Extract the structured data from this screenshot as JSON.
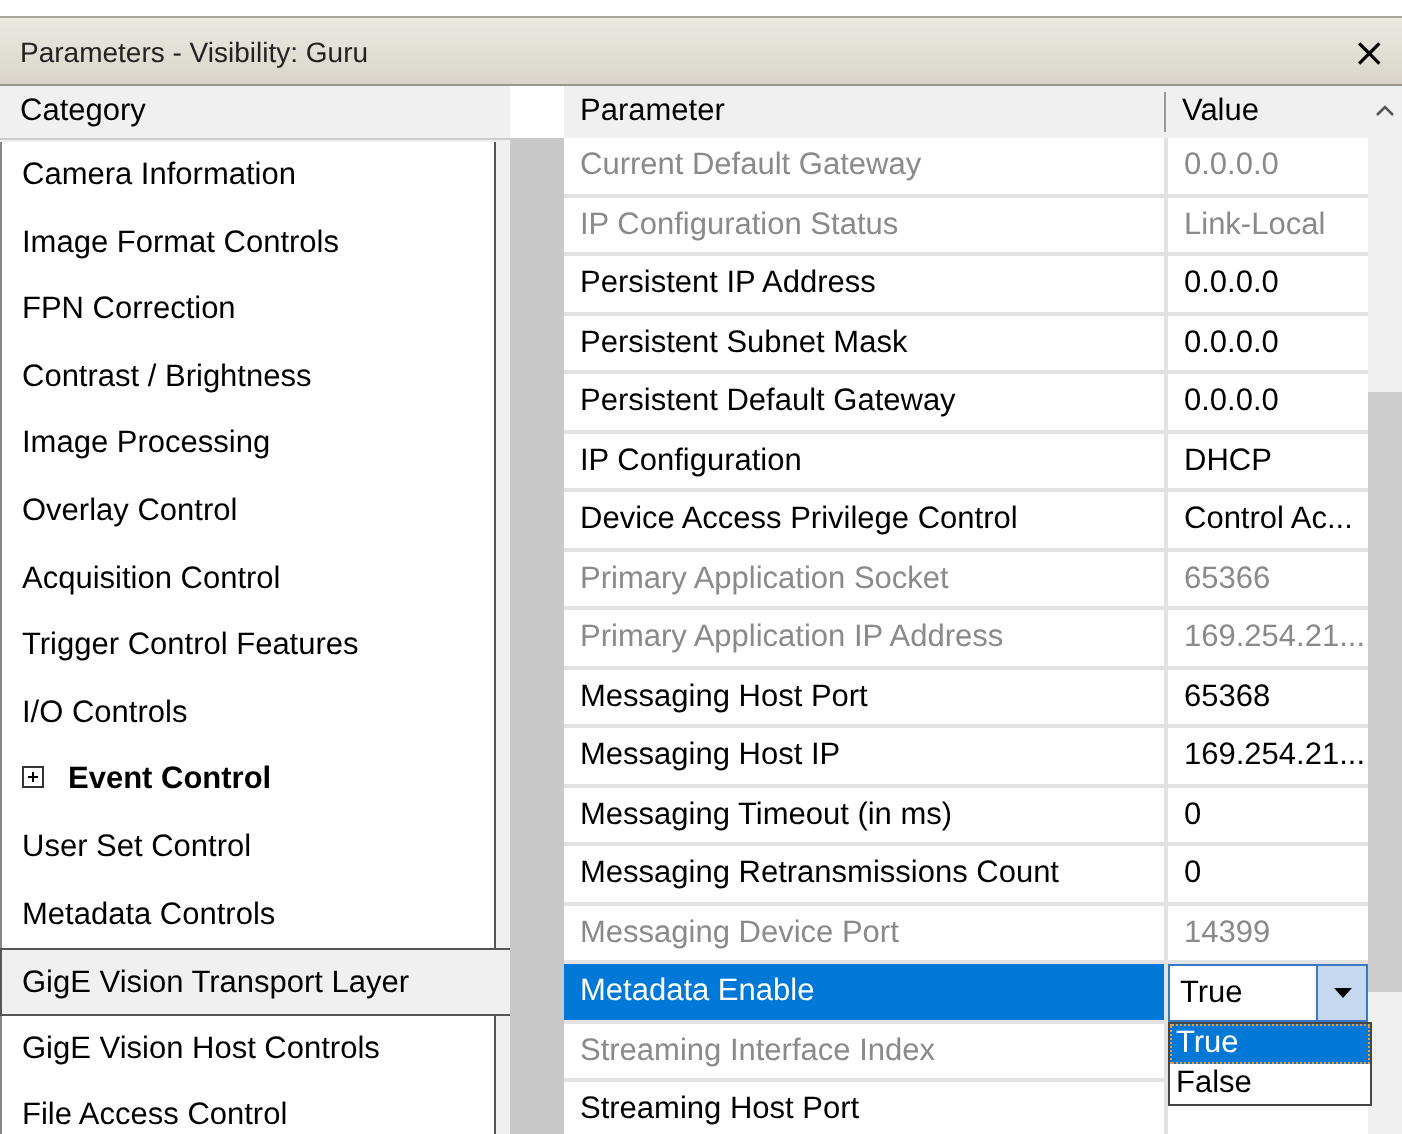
{
  "window": {
    "title": "Parameters - Visibility: Guru",
    "close": "×"
  },
  "category_header": "Category",
  "categories": [
    {
      "label": "Camera Information",
      "selected": false
    },
    {
      "label": "Image Format Controls",
      "selected": false
    },
    {
      "label": "FPN Correction",
      "selected": false
    },
    {
      "label": "Contrast / Brightness",
      "selected": false
    },
    {
      "label": "Image Processing",
      "selected": false
    },
    {
      "label": "Overlay Control",
      "selected": false
    },
    {
      "label": "Acquisition Control",
      "selected": false
    },
    {
      "label": "Trigger Control Features",
      "selected": false
    },
    {
      "label": "I/O Controls",
      "selected": false
    },
    {
      "label": "Event Control",
      "selected": false,
      "expanded": false
    },
    {
      "label": "User Set Control",
      "selected": false
    },
    {
      "label": "Metadata Controls",
      "selected": false
    },
    {
      "label": "GigE Vision Transport Layer",
      "selected": true
    },
    {
      "label": "GigE Vision Host Controls",
      "selected": false
    },
    {
      "label": "File Access Control",
      "selected": false
    }
  ],
  "table": {
    "columns": [
      "Parameter",
      "Value"
    ],
    "rows": [
      {
        "parameter": "Current Default Gateway",
        "value": "0.0.0.0",
        "disabled": true,
        "selected": false
      },
      {
        "parameter": "IP Configuration Status",
        "value": "Link-Local",
        "disabled": true,
        "selected": false
      },
      {
        "parameter": "Persistent IP Address",
        "value": "0.0.0.0",
        "disabled": false,
        "selected": false
      },
      {
        "parameter": "Persistent Subnet Mask",
        "value": "0.0.0.0",
        "disabled": false,
        "selected": false
      },
      {
        "parameter": "Persistent Default Gateway",
        "value": "0.0.0.0",
        "disabled": false,
        "selected": false
      },
      {
        "parameter": "IP Configuration",
        "value": "DHCP",
        "disabled": false,
        "selected": false
      },
      {
        "parameter": "Device Access Privilege Control",
        "value": "Control Ac...",
        "disabled": false,
        "selected": false
      },
      {
        "parameter": "Primary Application Socket",
        "value": "65366",
        "disabled": true,
        "selected": false
      },
      {
        "parameter": "Primary Application IP Address",
        "value": "169.254.21...",
        "disabled": true,
        "selected": false
      },
      {
        "parameter": "Messaging Host Port",
        "value": "65368",
        "disabled": false,
        "selected": false
      },
      {
        "parameter": "Messaging Host IP",
        "value": "169.254.21...",
        "disabled": false,
        "selected": false
      },
      {
        "parameter": "Messaging Timeout (in ms)",
        "value": "0",
        "disabled": false,
        "selected": false
      },
      {
        "parameter": "Messaging Retransmissions Count",
        "value": "0",
        "disabled": false,
        "selected": false
      },
      {
        "parameter": "Messaging Device Port",
        "value": "14399",
        "disabled": true,
        "selected": false
      },
      {
        "parameter": "Metadata Enable",
        "disabled": false,
        "selected": true,
        "dropdown": {
          "value": "True",
          "expanded": true,
          "options": [
            {
              "label": "True",
              "selected": true
            },
            {
              "label": "False",
              "selected": false
            }
          ]
        }
      },
      {
        "parameter": "Streaming Interface Index",
        "disabled": true,
        "selected": false
      },
      {
        "parameter": "Streaming Host Port",
        "disabled": false,
        "selected": false
      }
    ]
  }
}
